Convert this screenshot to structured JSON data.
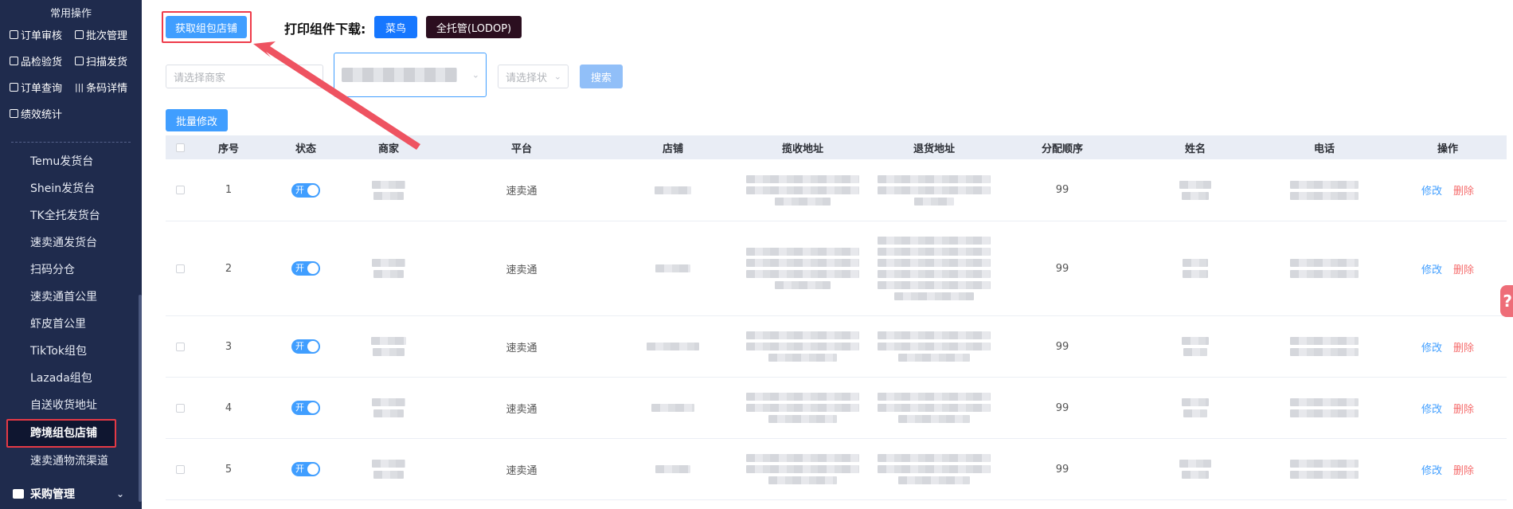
{
  "sidebar": {
    "quick_title": "常用操作",
    "quick_items": [
      "订单审核",
      "批次管理",
      "品检验货",
      "扫描发货",
      "订单查询",
      "条码详情",
      "绩效统计"
    ],
    "menu_items": [
      "Temu发货台",
      "Shein发货台",
      "TK全托发货台",
      "速卖通发货台",
      "扫码分仓",
      "速卖通首公里",
      "虾皮首公里",
      "TikTok组包",
      "Lazada组包",
      "自送收货地址",
      "跨境组包店铺",
      "速卖通物流渠道"
    ],
    "active_item": "跨境组包店铺",
    "group": "采购管理"
  },
  "toolbar": {
    "fetch_label": "获取组包店铺",
    "print_label": "打印组件下载:",
    "cainiao_label": "菜鸟",
    "lodop_label": "全托管(LODOP)",
    "merchant_placeholder": "请选择商家",
    "status_placeholder": "请选择状",
    "search_label": "搜索",
    "batch_label": "批量修改"
  },
  "table": {
    "headers": [
      "序号",
      "状态",
      "商家",
      "平台",
      "店铺",
      "揽收地址",
      "退货地址",
      "分配顺序",
      "姓名",
      "电话",
      "操作"
    ],
    "rows": [
      {
        "index": "1",
        "status": "开",
        "platform": "速卖通",
        "order": "99"
      },
      {
        "index": "2",
        "status": "开",
        "platform": "速卖通",
        "order": "99"
      },
      {
        "index": "3",
        "status": "开",
        "platform": "速卖通",
        "order": "99"
      },
      {
        "index": "4",
        "status": "开",
        "platform": "速卖通",
        "order": "99"
      },
      {
        "index": "5",
        "status": "开",
        "platform": "速卖通",
        "order": "99"
      }
    ],
    "edit_label": "修改",
    "delete_label": "删除"
  },
  "help": "?",
  "colors": {
    "sidebar": "#1f2b4d",
    "primary": "#409eff",
    "annotation": "#ee3b4a"
  }
}
